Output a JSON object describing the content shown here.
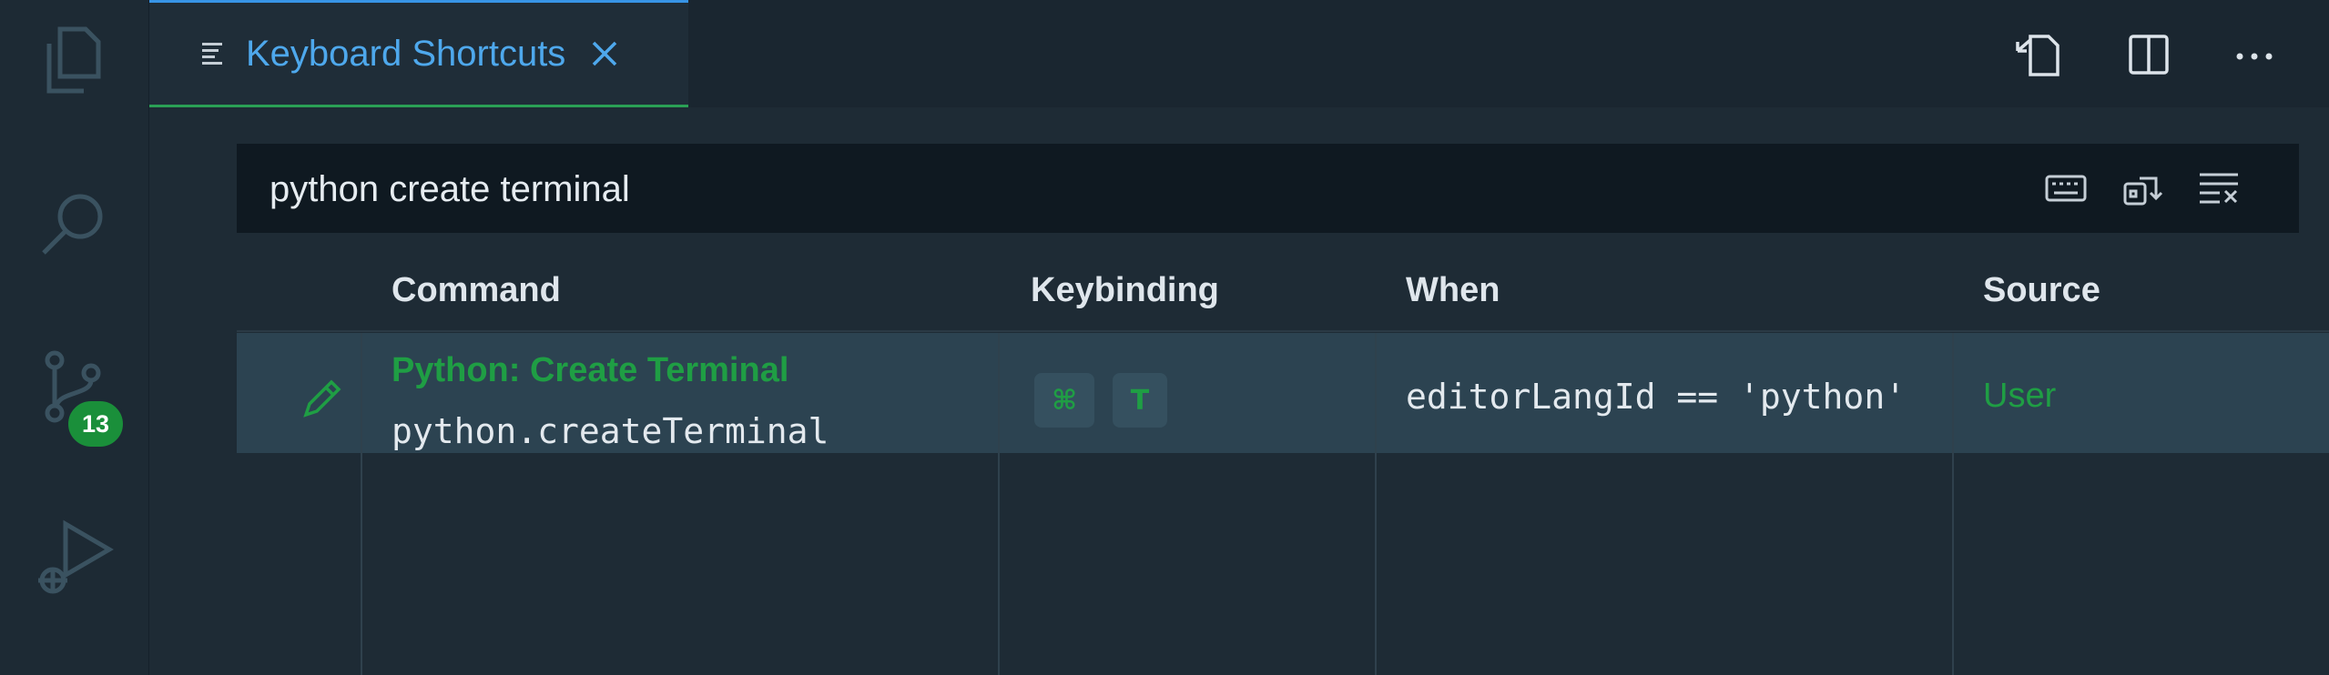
{
  "activity_bar": {
    "items": [
      {
        "name": "explorer-icon"
      },
      {
        "name": "search-icon"
      },
      {
        "name": "source-control-icon"
      },
      {
        "name": "run-debug-icon"
      }
    ],
    "source_control_badge": "13",
    "badge_color": "#1a8f3a"
  },
  "tab": {
    "title": "Keyboard Shortcuts",
    "icon": "keyboard-shortcuts-icon",
    "close_icon": "close-icon",
    "accent": "#4ea8ec"
  },
  "editor_actions": [
    {
      "name": "open-json-icon"
    },
    {
      "name": "split-editor-icon"
    },
    {
      "name": "more-actions-icon"
    }
  ],
  "search": {
    "value": "python create terminal",
    "buttons": [
      {
        "name": "record-keys-icon"
      },
      {
        "name": "sort-by-precedence-icon"
      },
      {
        "name": "clear-search-icon"
      }
    ]
  },
  "table": {
    "headers": {
      "command": "Command",
      "keybinding": "Keybinding",
      "when": "When",
      "source": "Source"
    },
    "rows": [
      {
        "command_title": "Python: Create Terminal",
        "command_id": "python.createTerminal",
        "keys": [
          "⌘",
          "T"
        ],
        "when": "editorLangId == 'python'",
        "source": "User"
      }
    ]
  },
  "colors": {
    "highlight_green": "#1f9e44",
    "row_selected": "#2c4351"
  }
}
